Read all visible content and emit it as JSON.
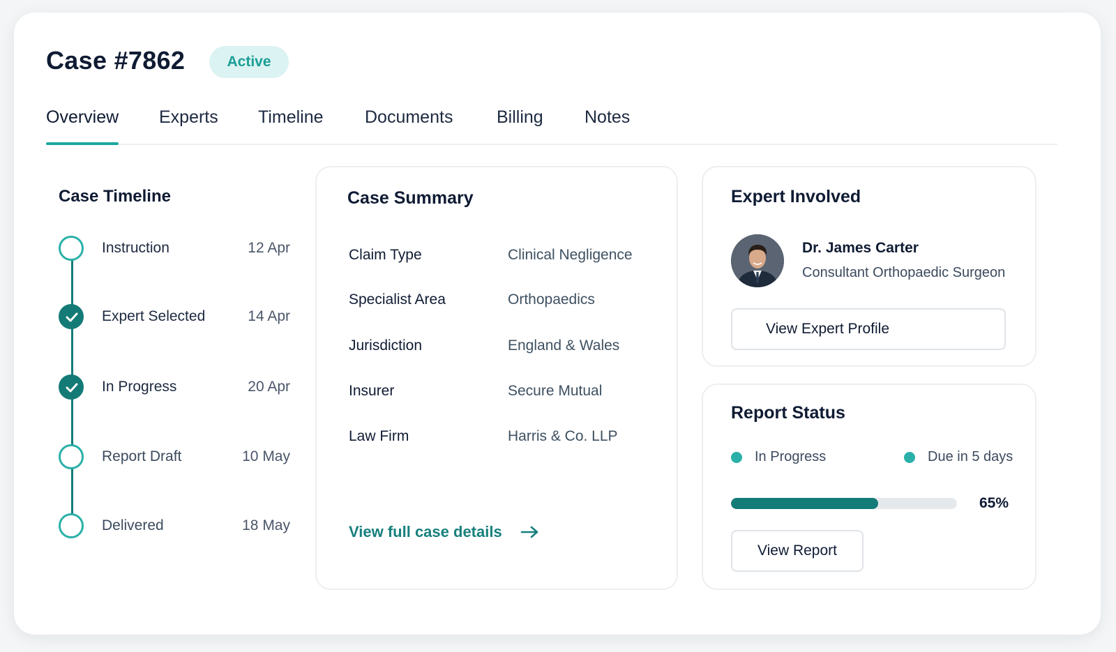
{
  "header": {
    "title": "Case #7862",
    "status_badge": "Active"
  },
  "tabs": [
    {
      "label": "Overview",
      "active": true
    },
    {
      "label": "Experts",
      "active": false
    },
    {
      "label": "Timeline",
      "active": false
    },
    {
      "label": "Documents",
      "active": false
    },
    {
      "label": "Billing",
      "active": false
    },
    {
      "label": "Notes",
      "active": false
    }
  ],
  "timeline": {
    "title": "Case Timeline",
    "steps": [
      {
        "label": "Instruction",
        "date": "12 Apr",
        "done": false
      },
      {
        "label": "Expert Selected",
        "date": "14 Apr",
        "done": true
      },
      {
        "label": "In Progress",
        "date": "20 Apr",
        "done": true
      },
      {
        "label": "Report Draft",
        "date": "10 May",
        "done": false
      },
      {
        "label": "Delivered",
        "date": "18 May",
        "done": false
      }
    ]
  },
  "summary": {
    "title": "Case Summary",
    "rows": [
      {
        "key": "Claim Type",
        "value": "Clinical Negligence"
      },
      {
        "key": "Specialist Area",
        "value": "Orthopaedics"
      },
      {
        "key": "Jurisdiction",
        "value": "England & Wales"
      },
      {
        "key": "Insurer",
        "value": "Secure Mutual"
      },
      {
        "key": "Law Firm",
        "value": "Harris & Co. LLP"
      }
    ],
    "link_label": "View full case details",
    "link_icon": "arrow-right-icon"
  },
  "expert": {
    "title": "Expert Involved",
    "name": "Dr. James Carter",
    "role": "Consultant Orthopaedic Surgeon",
    "button_label": "View Expert Profile"
  },
  "report": {
    "title": "Report Status",
    "status": "In Progress",
    "due": "Due in 5 days",
    "progress": 0.65,
    "progress_label": "65%",
    "button_label": "View Report"
  },
  "colors": {
    "accent": "#1ea79e",
    "accent_dark": "#137b78",
    "badge_bg": "#dbf3f2",
    "text": "#0f1b33"
  }
}
